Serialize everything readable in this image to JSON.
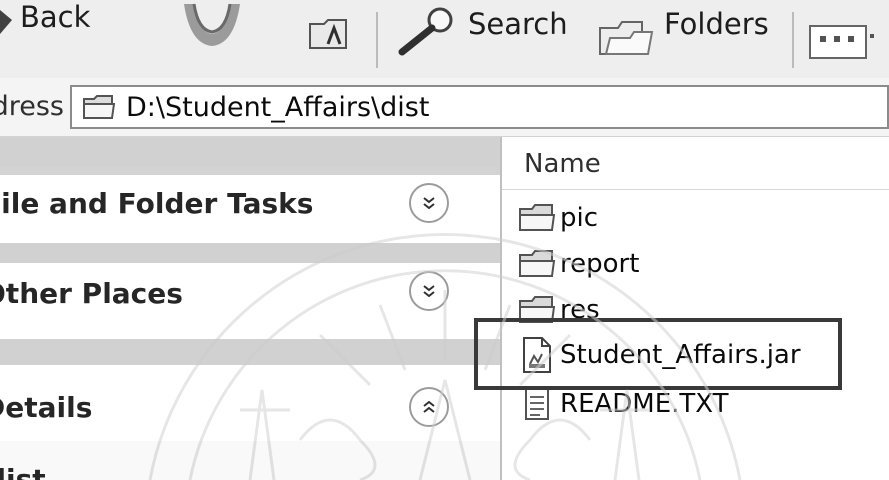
{
  "toolbar": {
    "back_label": "Back",
    "search_label": "Search",
    "folders_label": "Folders"
  },
  "address": {
    "label": "Address",
    "path": "D:\\Student_Affairs\\dist"
  },
  "task_pane": {
    "sections": [
      {
        "title": "File and Folder Tasks",
        "toggle": "»"
      },
      {
        "title": "Other Places",
        "toggle": "»"
      },
      {
        "title": "Details",
        "toggle": "«"
      }
    ],
    "details_name": "dist"
  },
  "file_list": {
    "column_name": "Name",
    "items": [
      {
        "name": "pic",
        "type": "folder"
      },
      {
        "name": "report",
        "type": "folder"
      },
      {
        "name": "res",
        "type": "folder"
      },
      {
        "name": "Student_Affairs.jar",
        "type": "jar"
      },
      {
        "name": "README.TXT",
        "type": "text"
      }
    ],
    "highlighted_item": "Student_Affairs.jar"
  },
  "icons": {
    "back": "back-arrow-icon",
    "forward": "forward-arrow-icon",
    "up": "up-folder-icon",
    "search": "search-magnifier-icon",
    "folders": "folders-icon",
    "views": "views-icon",
    "folder": "folder-icon",
    "jar": "jar-file-icon",
    "text": "text-file-icon"
  },
  "colors": {
    "highlight_border": "#3c3c3c",
    "pane_strip": "#cdcdcd"
  }
}
